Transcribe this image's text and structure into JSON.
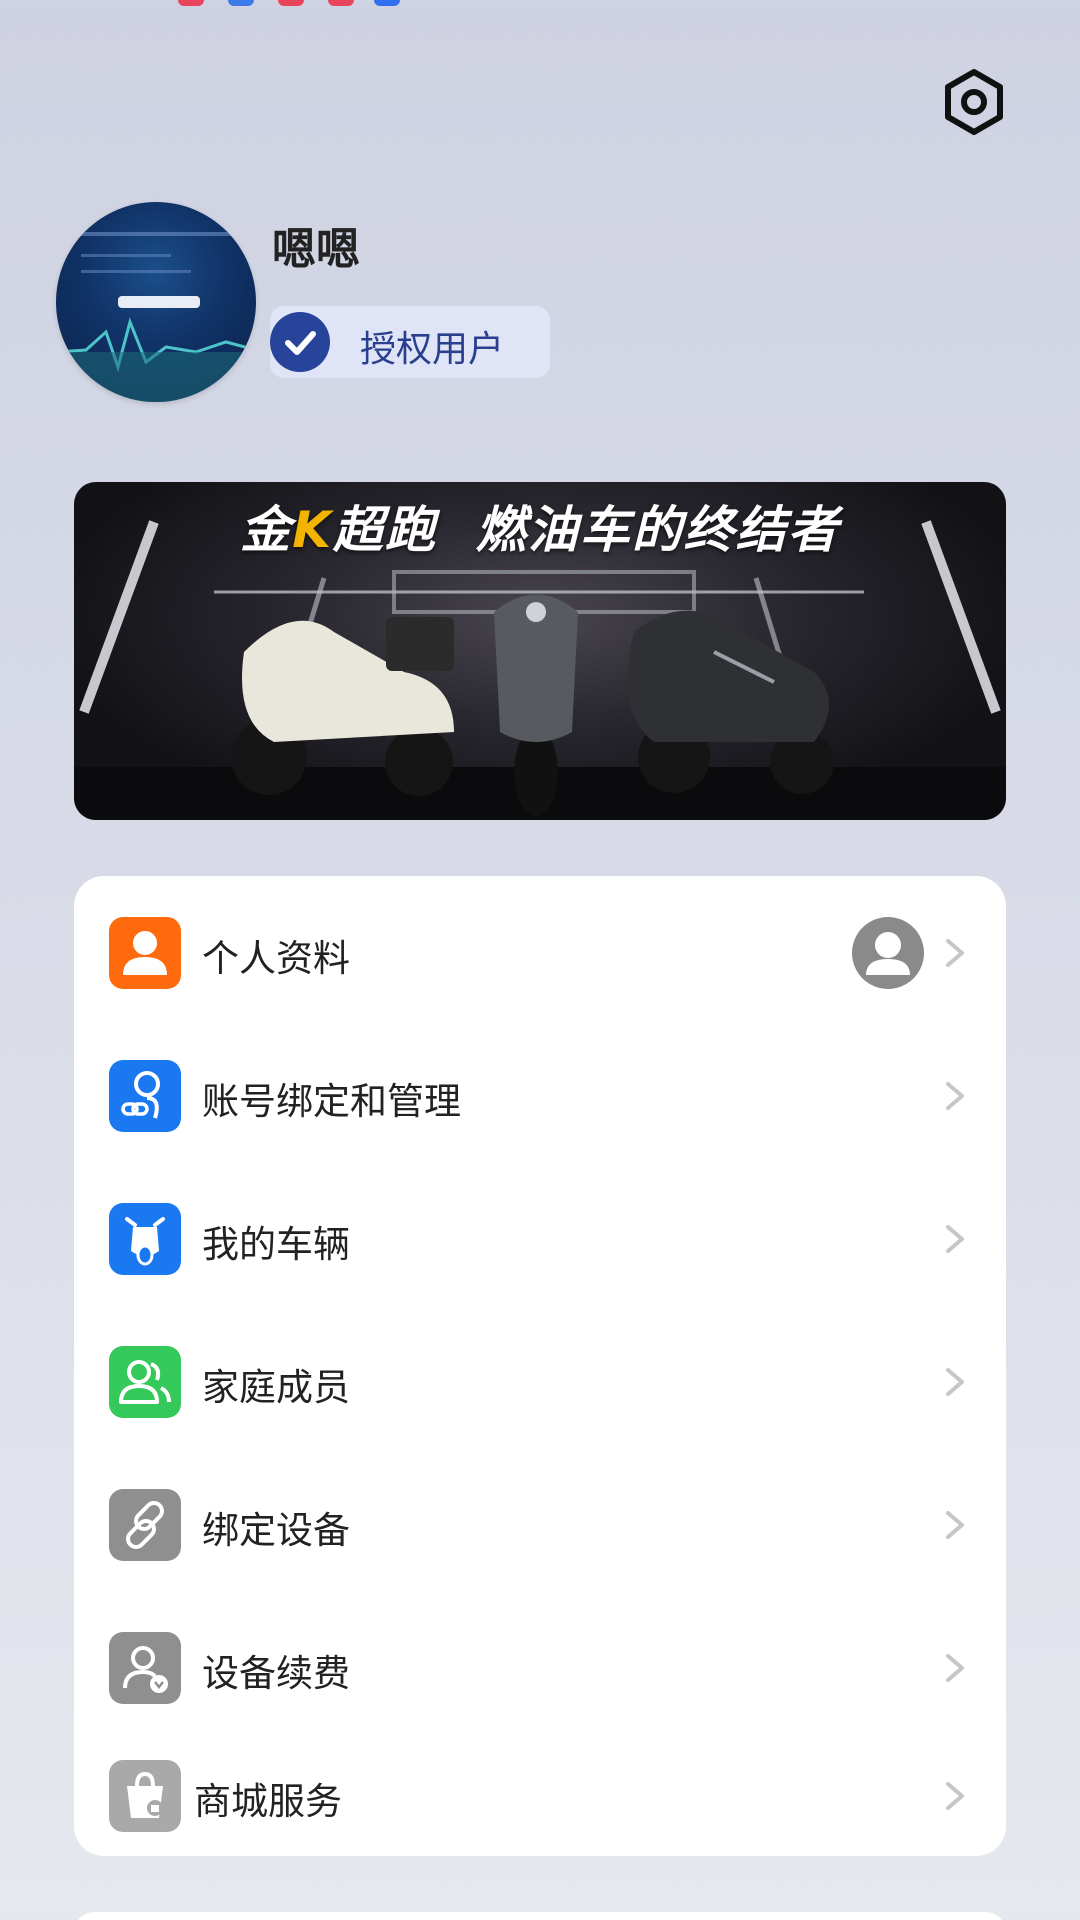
{
  "colors": {
    "accent": "#27439a",
    "profile": "#fe6a0c",
    "account": "#1a79f0",
    "vehicle": "#1a79f0",
    "family": "#35c85b",
    "bind": "#8f8f8f",
    "renew": "#8f8f8f",
    "mall": "#a9a9a9"
  },
  "header": {
    "settings_icon": "settings-hex-icon"
  },
  "user": {
    "name": "嗯嗯",
    "badge": "授权用户"
  },
  "banner": {
    "title_a": "金",
    "title_k": "K",
    "title_b": "超跑  燃油车的终结者"
  },
  "menu": {
    "items": [
      {
        "label": "个人资料",
        "icon": "person-icon"
      },
      {
        "label": "账号绑定和管理",
        "icon": "account-link-icon"
      },
      {
        "label": "我的车辆",
        "icon": "scooter-icon"
      },
      {
        "label": "家庭成员",
        "icon": "family-icon"
      },
      {
        "label": "绑定设备",
        "icon": "link-icon"
      },
      {
        "label": "设备续费",
        "icon": "renew-icon"
      },
      {
        "label": "商城服务",
        "icon": "shopping-bag-icon"
      }
    ]
  }
}
